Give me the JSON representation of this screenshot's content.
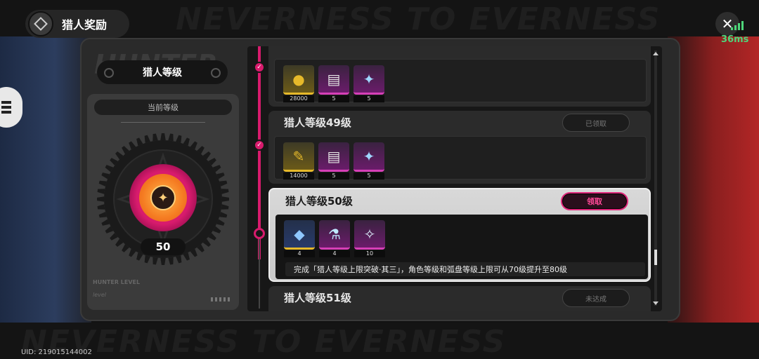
{
  "watermark": {
    "text": "NEVERNESS TO EVERNESS"
  },
  "header": {
    "title": "猎人奖励"
  },
  "status": {
    "ping": "36ms"
  },
  "left": {
    "watermark": "HUNTER",
    "title": "猎人等级",
    "card_header": "当前等级",
    "level": "50",
    "footer_brand": "HUNTER LEVEL",
    "footer_sub": "level"
  },
  "entries": [
    {
      "title": "",
      "status": "",
      "rewards": [
        {
          "icon": "gold-coin-icon",
          "glyph": "●",
          "rarity": "gold",
          "count": "28000"
        },
        {
          "icon": "document-icon",
          "glyph": "▤",
          "rarity": "purple",
          "count": "5"
        },
        {
          "icon": "crystal-icon",
          "glyph": "✦",
          "rarity": "purple",
          "count": "5"
        }
      ]
    },
    {
      "title": "猎人等级49级",
      "status": "已领取",
      "rewards": [
        {
          "icon": "ticket-icon",
          "glyph": "✎",
          "rarity": "gold",
          "count": "14000"
        },
        {
          "icon": "document-icon",
          "glyph": "▤",
          "rarity": "purple",
          "count": "5"
        },
        {
          "icon": "crystal-icon",
          "glyph": "✦",
          "rarity": "purple",
          "count": "5"
        }
      ]
    },
    {
      "title": "猎人等级50级",
      "claim": "领取",
      "rewards": [
        {
          "icon": "cube-icon",
          "glyph": "◆",
          "rarity": "blue",
          "count": "4"
        },
        {
          "icon": "potion-icon",
          "glyph": "⚗",
          "rarity": "purple",
          "count": "4"
        },
        {
          "icon": "gem-cluster-icon",
          "glyph": "✧",
          "rarity": "purple",
          "count": "10"
        }
      ],
      "description": "完成「猎人等级上限突破·其三」，角色等级和弧盘等级上限可从70级提升至80级"
    },
    {
      "title": "猎人等级51级",
      "status": "未达成"
    }
  ],
  "footer": {
    "uid": "UID: 219015144002"
  },
  "colors": {
    "accent": "#d81b6d",
    "ping": "#4ed67a",
    "gold": "#e6b92a"
  }
}
